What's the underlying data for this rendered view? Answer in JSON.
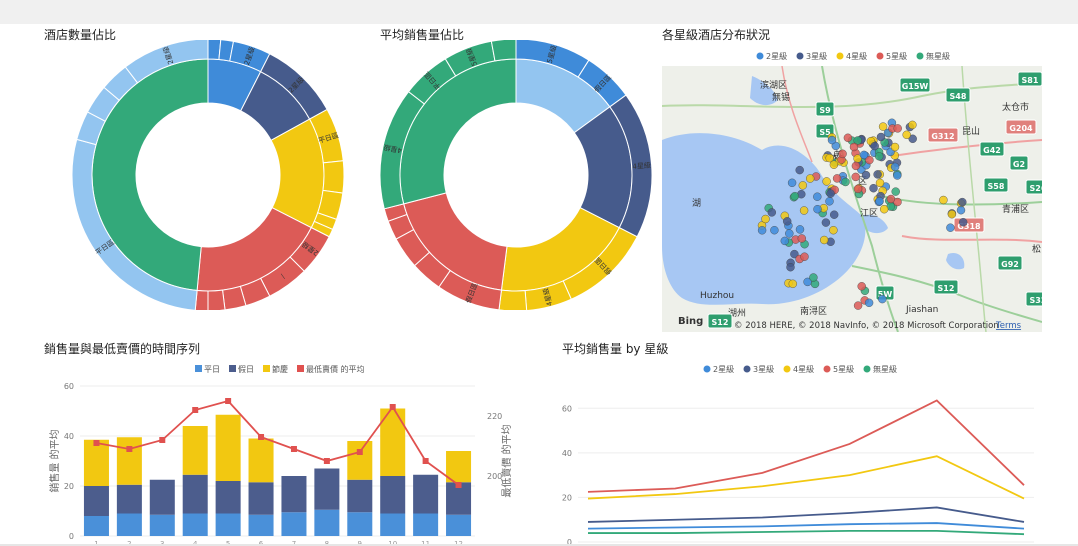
{
  "titles": {
    "hotel_count": "酒店數量佔比",
    "avg_sales_share": "平均銷售量佔比",
    "map": "各星級酒店分布狀況",
    "timeseries": "銷售量與最低賣價的時間序列",
    "avg_sales_by_star": "平均銷售量 by 星級"
  },
  "map": {
    "legend": [
      "2星級",
      "3星級",
      "4星級",
      "5星級",
      "無星級"
    ],
    "places": [
      "滨湖区",
      "無锡",
      "太仓市",
      "昆山",
      "青浦区",
      "湖州",
      "南浔区",
      "Huzhou",
      "Jiashan",
      "松",
      "太",
      "湖",
      "苏",
      "区",
      "江区"
    ],
    "road_labels": [
      "S81",
      "G15W",
      "S48",
      "G204",
      "G312",
      "G42",
      "G2",
      "S58",
      "S26",
      "G318",
      "G92",
      "S9",
      "S5",
      "S12",
      "S32",
      "5W",
      "S12"
    ],
    "bing": "Bing",
    "copyright": "© 2018 HERE, © 2018 NavInfo, © 2018 Microsoft Corporation",
    "terms": "Terms"
  },
  "colors": {
    "2星級": "#3f8bd9",
    "3星級": "#465b8c",
    "4星級": "#f2c811",
    "5星級": "#dc5b57",
    "無星級": "#33a97a",
    "outer_blue": "#93c5f0",
    "平日": "#4a90d9",
    "假日": "#4c5d8d",
    "節慶": "#f2c811",
    "最低賣價 的平均": "#e0514f"
  },
  "chart_data": [
    {
      "type": "pie",
      "name": "hotel_count",
      "title": "酒店數量佔比",
      "inner": [
        {
          "label": "2星級",
          "value": 7.5
        },
        {
          "label": "3星級",
          "value": 9.5
        },
        {
          "label": "4星級",
          "value": 15.5
        },
        {
          "label": "5星級",
          "value": 19
        },
        {
          "label": "無星級",
          "value": 48.5
        }
      ],
      "outer_labels": [
        "2星級",
        "2星級",
        "平日區",
        "2星級",
        "—",
        "平日區",
        "2星級",
        "假日區",
        "2星級",
        "—",
        "—",
        "假日區"
      ]
    },
    {
      "type": "pie",
      "name": "avg_sales_share",
      "title": "平均銷售量佔比",
      "inner": [
        {
          "label": "2星級",
          "value": 15
        },
        {
          "label": "3星級",
          "value": 17.5
        },
        {
          "label": "4星級",
          "value": 19.5
        },
        {
          "label": "5星級",
          "value": 19
        },
        {
          "label": "無星級",
          "value": 29
        }
      ],
      "outer_labels": [
        "5星級",
        "假日區",
        "4星級",
        "假日區",
        "4星級",
        "假日區",
        "4星級",
        "平日區",
        "5星級",
        "—",
        "4星級",
        "平日區",
        "3"
      ]
    },
    {
      "type": "bar",
      "stacked": true,
      "title": "銷售量與最低賣價的時間序列",
      "legend": [
        "平日",
        "假日",
        "節慶",
        "最低賣價 的平均"
      ],
      "ylabel": "銷售量 的平均",
      "y2label": "最低賣價 的平均",
      "ylim": [
        0,
        60
      ],
      "yticks": [
        0,
        20,
        40,
        60
      ],
      "y2ticks": [
        200,
        220
      ],
      "categories": [
        "1",
        "2",
        "3",
        "4",
        "5",
        "6",
        "7",
        "8",
        "9",
        "10",
        "11",
        "12"
      ],
      "series": [
        {
          "name": "平日",
          "values": [
            8,
            9,
            8.5,
            9,
            9,
            8.5,
            9.5,
            10.5,
            9.5,
            9,
            9,
            8.5
          ]
        },
        {
          "name": "假日",
          "values": [
            12,
            11.5,
            14,
            15.5,
            13,
            13,
            14.5,
            16.5,
            13,
            15,
            15.5,
            13
          ]
        },
        {
          "name": "節慶",
          "values": [
            18.5,
            19,
            0,
            19.5,
            26.5,
            17.5,
            0,
            0,
            15.5,
            27,
            0,
            12.5
          ]
        }
      ],
      "line": {
        "name": "最低賣價 的平均",
        "values": [
          211,
          209,
          212,
          222,
          225,
          213,
          209,
          205,
          208,
          223,
          205,
          197
        ]
      }
    },
    {
      "type": "line",
      "title": "平均銷售量 by 星級",
      "legend": [
        "2星級",
        "3星級",
        "4星級",
        "5星級",
        "無星級"
      ],
      "ylim": [
        0,
        70
      ],
      "yticks": [
        0,
        20,
        40,
        60
      ],
      "series": [
        {
          "name": "2星級",
          "values": [
            6,
            6.5,
            7,
            8,
            8.5,
            6
          ]
        },
        {
          "name": "3星級",
          "values": [
            9,
            10,
            11,
            13,
            15.5,
            9
          ]
        },
        {
          "name": "4星級",
          "values": [
            19.5,
            21.5,
            25,
            30,
            38.5,
            19.5
          ]
        },
        {
          "name": "5星級",
          "values": [
            22.5,
            24,
            31,
            44,
            63.5,
            25.5
          ]
        },
        {
          "name": "無星級",
          "values": [
            4,
            4,
            4.5,
            5,
            5,
            3.5
          ]
        }
      ]
    }
  ]
}
